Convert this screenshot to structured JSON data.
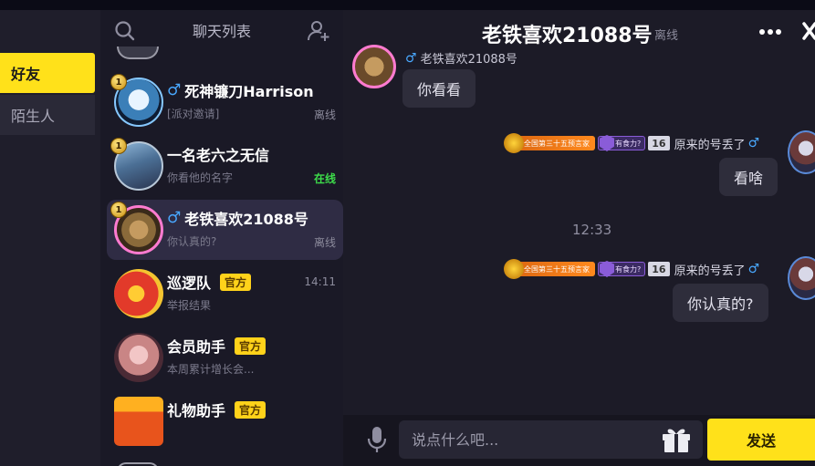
{
  "categories": {
    "friends": "好友",
    "strangers": "陌生人"
  },
  "chat_list": {
    "title": "聊天列表",
    "items": [
      {
        "name": "死神镰刀Harrison",
        "gender_icon": "male-icon",
        "rank": "1",
        "preview": "[派对邀请]",
        "status": "离线"
      },
      {
        "name": "一名老六之无信",
        "rank": "1",
        "preview": "你看他的名字",
        "status": "在线"
      },
      {
        "name": "老铁喜欢21088号",
        "gender_icon": "male-icon",
        "rank": "1",
        "preview": "你认真的?",
        "status": "离线"
      },
      {
        "name": "巡逻队",
        "badge": "官方",
        "preview": "举报结果",
        "time": "14:11"
      },
      {
        "name": "会员助手",
        "badge": "官方",
        "preview": "本周累计增长会..."
      },
      {
        "name": "礼物助手",
        "badge": "官方"
      }
    ]
  },
  "conversation": {
    "title": "老铁喜欢21088号",
    "status": "离线",
    "peer_name": "老铁喜欢21088号",
    "messages": [
      {
        "from": "peer",
        "text": "你看看"
      },
      {
        "from": "me",
        "sender": "原来的号丢了",
        "medal_text": "全国第三十五预言家",
        "heart_text": "有食力?",
        "level": "16",
        "text": "看啥"
      },
      {
        "from": "me",
        "sender": "原来的号丢了",
        "medal_text": "全国第三十五预言家",
        "heart_text": "有食力?",
        "level": "16",
        "text": "你认真的?"
      }
    ],
    "time_divider": "12:33"
  },
  "composer": {
    "placeholder": "说点什么吧...",
    "send_label": "发送"
  },
  "colors": {
    "accent": "#ffe11a",
    "online": "#3ddc4a",
    "male": "#49a8ff"
  }
}
